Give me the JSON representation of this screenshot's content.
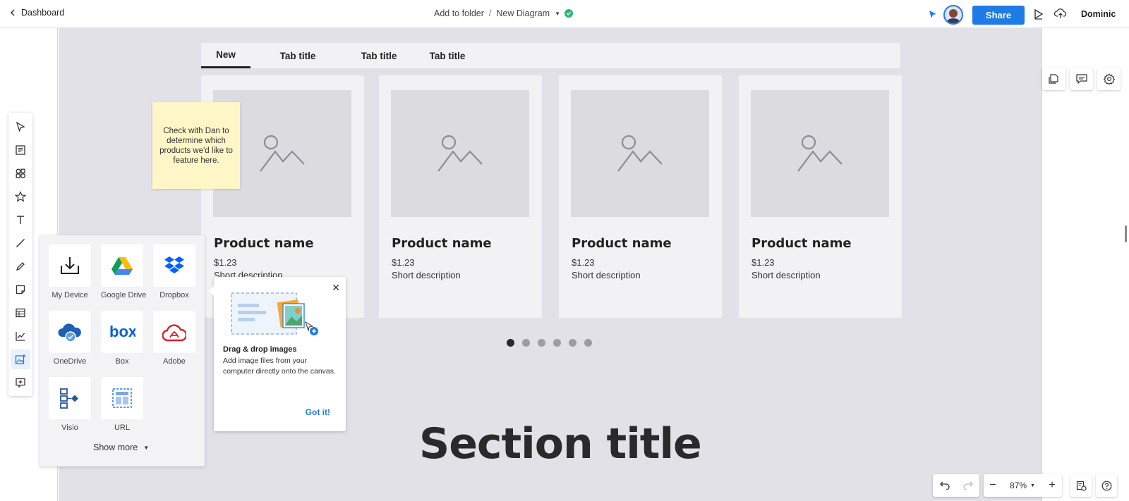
{
  "topbar": {
    "back_label": "Dashboard",
    "folder_label": "Add to folder",
    "separator": "/",
    "doc_title": "New Diagram",
    "share_label": "Share",
    "username": "Dominic"
  },
  "tabs": [
    {
      "label": "New",
      "active": true
    },
    {
      "label": "Tab title",
      "active": false
    },
    {
      "label": "Tab title",
      "active": false
    },
    {
      "label": "Tab title",
      "active": false
    }
  ],
  "cards": [
    {
      "name": "Product name",
      "price": "$1.23",
      "desc": "Short description"
    },
    {
      "name": "Product name",
      "price": "$1.23",
      "desc": "Short description"
    },
    {
      "name": "Product name",
      "price": "$1.23",
      "desc": "Short description"
    },
    {
      "name": "Product name",
      "price": "$1.23",
      "desc": "Short description"
    }
  ],
  "carousel": {
    "count": 6,
    "active_index": 0
  },
  "sticky_note": "Check with Dan to determine which products we'd like to feature here.",
  "section_title": "Section title",
  "import_panel": {
    "sources": [
      {
        "label": "My Device",
        "icon": "download-icon"
      },
      {
        "label": "Google Drive",
        "icon": "google-drive-icon"
      },
      {
        "label": "Dropbox",
        "icon": "dropbox-icon"
      },
      {
        "label": "OneDrive",
        "icon": "onedrive-icon"
      },
      {
        "label": "Box",
        "icon": "box-icon"
      },
      {
        "label": "Adobe",
        "icon": "adobe-icon"
      },
      {
        "label": "Visio",
        "icon": "visio-icon"
      },
      {
        "label": "URL",
        "icon": "url-icon"
      }
    ],
    "show_more": "Show more"
  },
  "tooltip": {
    "title": "Drag & drop images",
    "body": "Add image files from your computer directly onto the canvas.",
    "action": "Got it!"
  },
  "zoom": {
    "value": "87%"
  },
  "colors": {
    "accent": "#1f7be6",
    "canvas": "#e2e1e7",
    "sticky": "#fff6c8",
    "saved": "#2bb673"
  }
}
